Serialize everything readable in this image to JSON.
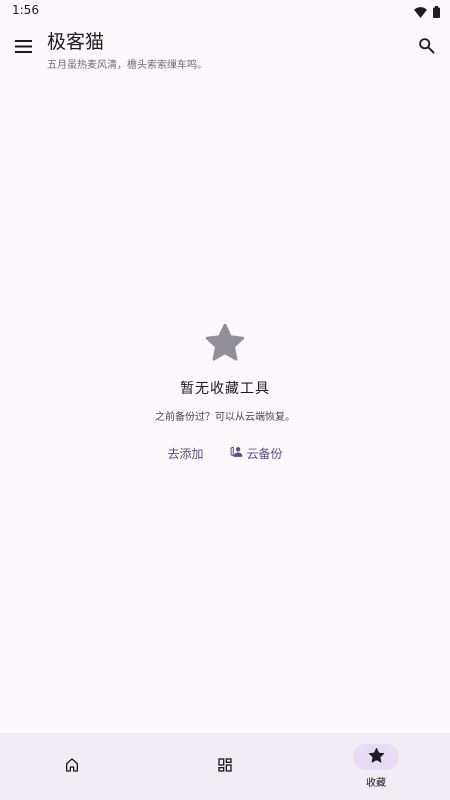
{
  "status_bar": {
    "time": "1:56",
    "icons": [
      "wifi-icon",
      "battery-icon"
    ]
  },
  "app_bar": {
    "title": "极客猫",
    "subtitle": "五月虽热麦风清，檐头索索缫车鸣。",
    "icons": [
      "menu-icon",
      "search-icon"
    ]
  },
  "empty_state": {
    "icon": "star-icon",
    "title": "暂无收藏工具",
    "description": "之前备份过？可以从云端恢复。",
    "add_label": "去添加",
    "backup_label": "云备份",
    "backup_icon": "cloud-backup-icon"
  },
  "bottom_nav": {
    "items": [
      {
        "icon": "home-icon",
        "label": ""
      },
      {
        "icon": "grid-icon",
        "label": ""
      },
      {
        "icon": "star-icon",
        "label": "收藏",
        "active": true
      }
    ]
  },
  "colors": {
    "background": "#fdf8fc",
    "accent": "#5b4d8a",
    "nav_background": "#f2ecf4",
    "nav_active_pill": "#e6dcf6",
    "empty_star": "#938f99"
  }
}
